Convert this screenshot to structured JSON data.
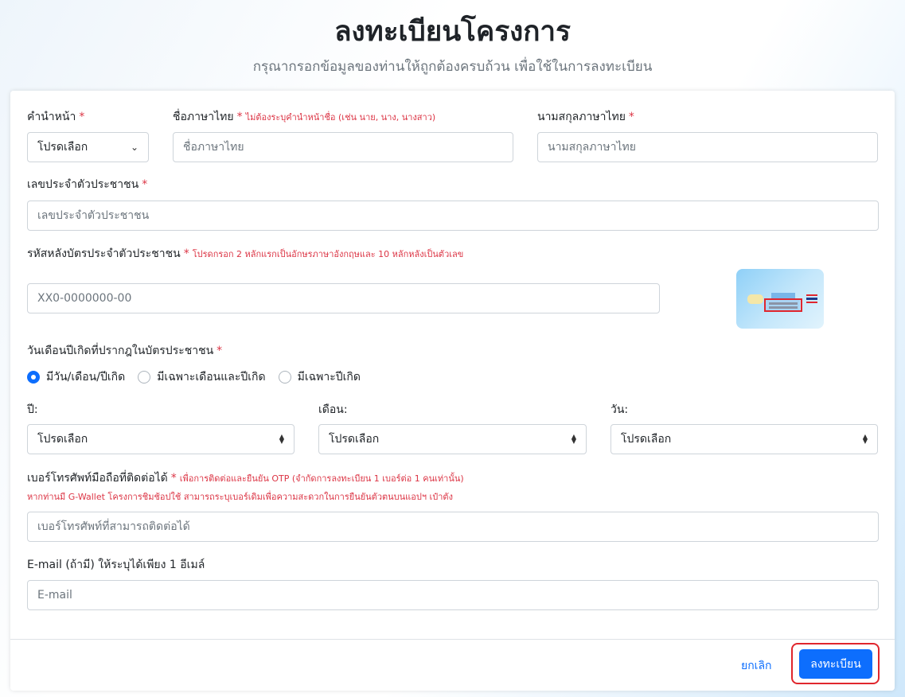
{
  "header": {
    "title": "ลงทะเบียนโครงการ",
    "subtitle": "กรุณากรอกข้อมูลของท่านให้ถูกต้องครบถ้วน เพื่อใช้ในการลงทะเบียน"
  },
  "form": {
    "prefix": {
      "label": "คำนำหน้า",
      "required": "*",
      "value": "โปรดเลือก"
    },
    "first_name": {
      "label": "ชื่อภาษาไทย",
      "required": "*",
      "note": "ไม่ต้องระบุคำนำหน้าชื่อ (เช่น นาย, นาง, นางสาว)",
      "placeholder": "ชื่อภาษาไทย"
    },
    "last_name": {
      "label": "นามสกุลภาษาไทย",
      "required": "*",
      "placeholder": "นามสกุลภาษาไทย"
    },
    "citizen_id": {
      "label": "เลขประจำตัวประชาชน",
      "required": "*",
      "placeholder": "เลขประจำตัวประชาชน"
    },
    "laser_code": {
      "label": "รหัสหลังบัตรประจำตัวประชาชน",
      "required": "*",
      "note": "โปรดกรอก 2 หลักแรกเป็นอักษรภาษาอังกฤษและ 10 หลักหลังเป็นตัวเลข",
      "placeholder": "XX0-0000000-00"
    },
    "dob": {
      "label": "วันเดือนปีเกิดที่ปรากฎในบัตรประชาชน",
      "required": "*",
      "options": [
        "มีวัน/เดือน/ปีเกิด",
        "มีเฉพาะเดือนและปีเกิด",
        "มีเฉพาะปีเกิด"
      ],
      "selected": 0,
      "year": {
        "label": "ปี:",
        "value": "โปรดเลือก"
      },
      "month": {
        "label": "เดือน:",
        "value": "โปรดเลือก"
      },
      "day": {
        "label": "วัน:",
        "value": "โปรดเลือก"
      }
    },
    "phone": {
      "label": "เบอร์โทรศัพท์มือถือที่ติดต่อได้",
      "required": "*",
      "note": "เพื่อการติดต่อและยืนยัน OTP (จำกัดการลงทะเบียน 1 เบอร์ต่อ 1 คนเท่านั้น)",
      "note2": "หากท่านมี G-Wallet โครงการชิมช้อปใช้ สามารถระบุเบอร์เดิมเพื่อความสะดวกในการยืนยันตัวตนบนแอปฯ เป๋าตัง",
      "placeholder": "เบอร์โทรศัพท์ที่สามารถติดต่อได้"
    },
    "email": {
      "label": "E-mail (ถ้ามี) ให้ระบุได้เพียง 1 อีเมล์",
      "placeholder": "E-mail"
    }
  },
  "footer": {
    "cancel_label": "ยกเลิก",
    "submit_label": "ลงทะเบียน"
  },
  "colors": {
    "primary": "#0d6efd",
    "required": "#dc3545",
    "highlight": "#e0262d"
  },
  "icons": {
    "select": "chevron-down-icon",
    "sort": "sort-arrows-icon",
    "card_illustration": "id-card-back-icon"
  }
}
